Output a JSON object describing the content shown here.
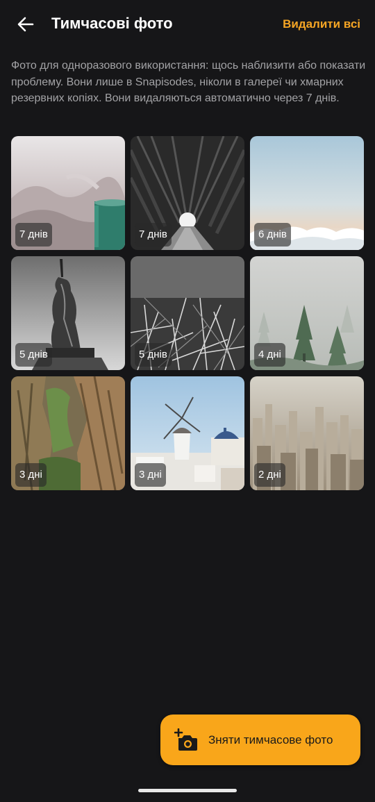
{
  "header": {
    "title": "Тимчасові фото",
    "delete_all_label": "Видалити всі",
    "back_icon": "arrow-left-icon"
  },
  "description": "Фото для одноразового використання: щось наблизити або показати проблему. Вони лише в Snapisodes, ніколи в галереї чи хмарних резервних копіях. Вони видаляються автоматично через 7 днів.",
  "photos": [
    {
      "subject": "cup on blanket",
      "days_left": "7 днів"
    },
    {
      "subject": "tree tunnel",
      "days_left": "7 днів"
    },
    {
      "subject": "sky above clouds",
      "days_left": "6 днів"
    },
    {
      "subject": "statue of liberty",
      "days_left": "5 днів"
    },
    {
      "subject": "grass closeup",
      "days_left": "5 днів"
    },
    {
      "subject": "misty forest",
      "days_left": "4 дні"
    },
    {
      "subject": "rock cliffs",
      "days_left": "3 дні"
    },
    {
      "subject": "santorini windmill",
      "days_left": "3 дні"
    },
    {
      "subject": "city aerial",
      "days_left": "2 дні"
    }
  ],
  "fab": {
    "label": "Зняти тимчасове фото",
    "icon": "add-camera-icon",
    "color": "#f9a61a"
  },
  "colors": {
    "background": "#161618",
    "accent": "#f5a524",
    "description_text": "#a3a3a6"
  }
}
